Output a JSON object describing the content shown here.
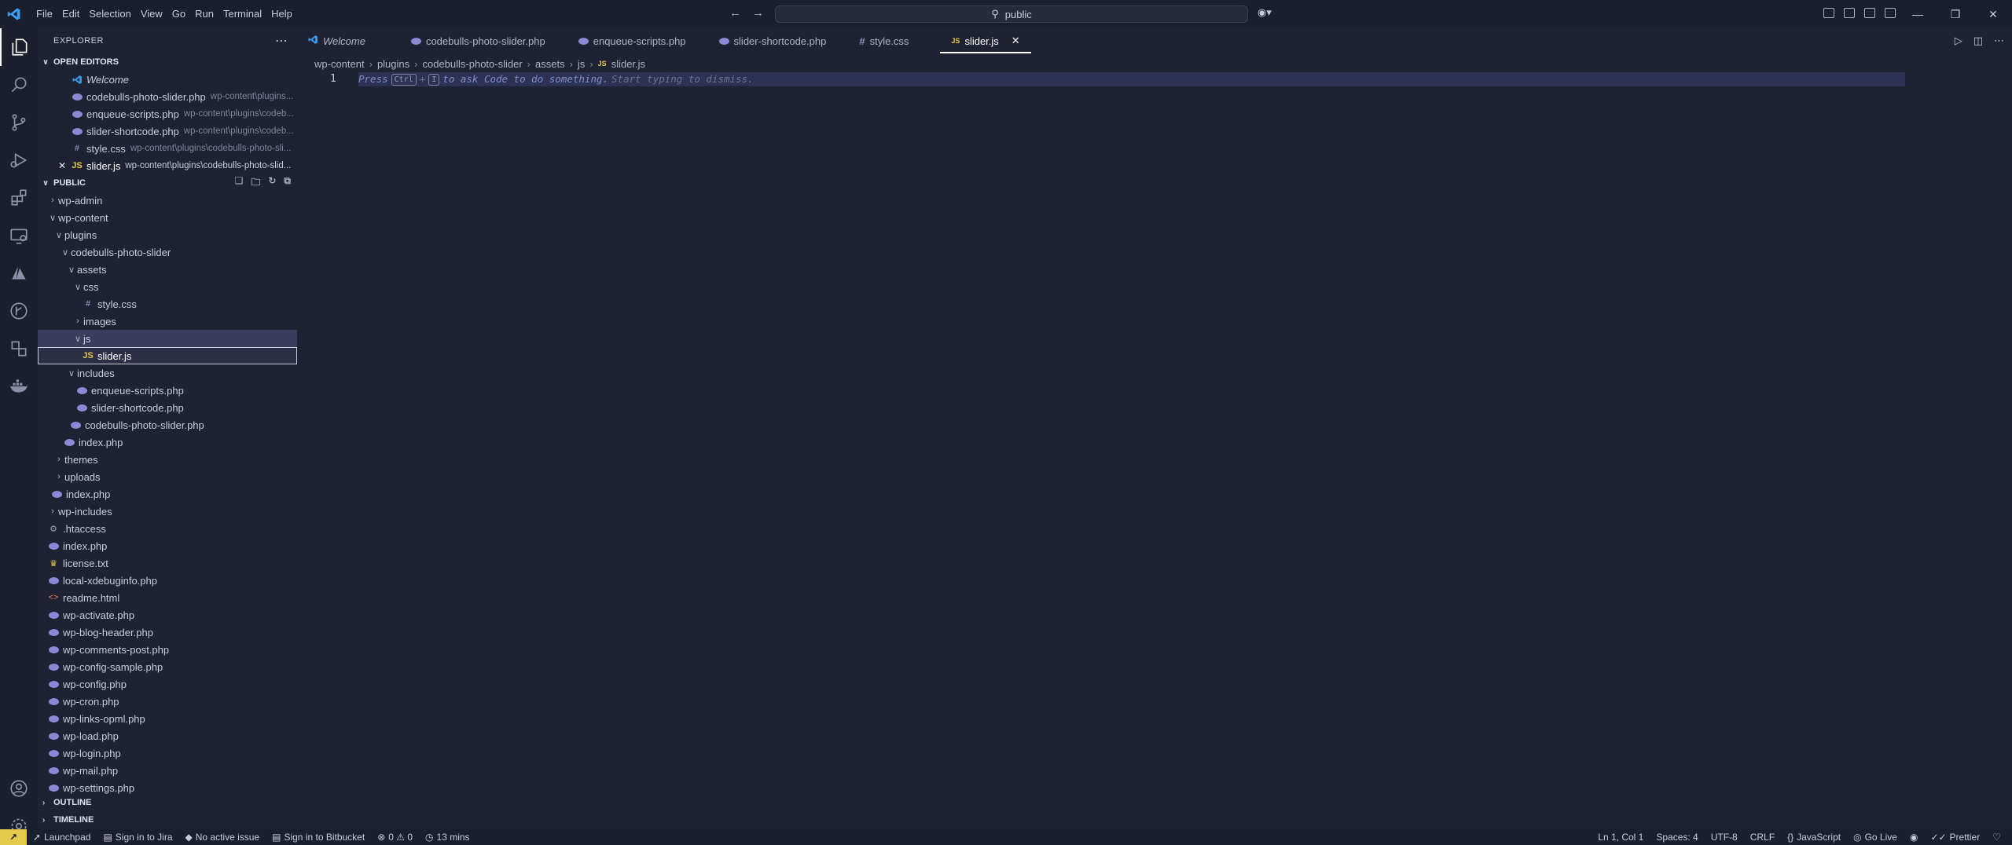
{
  "menu": [
    "File",
    "Edit",
    "Selection",
    "View",
    "Go",
    "Run",
    "Terminal",
    "Help"
  ],
  "command_center": {
    "label": "public"
  },
  "sidebar": {
    "title": "EXPLORER",
    "open_editors": {
      "header": "OPEN EDITORS",
      "items": [
        {
          "name": "Welcome",
          "desc": ""
        },
        {
          "name": "codebulls-photo-slider.php",
          "desc": "wp-content\\plugins..."
        },
        {
          "name": "enqueue-scripts.php",
          "desc": "wp-content\\plugins\\codeb..."
        },
        {
          "name": "slider-shortcode.php",
          "desc": "wp-content\\plugins\\codeb..."
        },
        {
          "name": "style.css",
          "desc": "wp-content\\plugins\\codebulls-photo-sli..."
        },
        {
          "name": "slider.js",
          "desc": "wp-content\\plugins\\codebulls-photo-slid..."
        }
      ]
    },
    "workspace": {
      "header": "PUBLIC",
      "items": [
        "wp-admin",
        "wp-content",
        "plugins",
        "codebulls-photo-slider",
        "assets",
        "css",
        "style.css",
        "images",
        "js",
        "slider.js",
        "includes",
        "enqueue-scripts.php",
        "slider-shortcode.php",
        "codebulls-photo-slider.php",
        "index.php",
        "themes",
        "uploads",
        "index.php",
        "wp-includes",
        ".htaccess",
        "index.php",
        "license.txt",
        "local-xdebuginfo.php",
        "readme.html",
        "wp-activate.php",
        "wp-blog-header.php",
        "wp-comments-post.php",
        "wp-config-sample.php",
        "wp-config.php",
        "wp-cron.php",
        "wp-links-opml.php",
        "wp-load.php",
        "wp-login.php",
        "wp-mail.php",
        "wp-settings.php"
      ]
    },
    "outline": "OUTLINE",
    "timeline": "TIMELINE"
  },
  "tabs": [
    "Welcome",
    "codebulls-photo-slider.php",
    "enqueue-scripts.php",
    "slider-shortcode.php",
    "style.css",
    "slider.js"
  ],
  "breadcrumb": [
    "wp-content",
    "plugins",
    "codebulls-photo-slider",
    "assets",
    "js",
    "slider.js"
  ],
  "editor": {
    "line_number": "1",
    "hint_press": "Press",
    "hint_key1": "Ctrl",
    "hint_plus": "+",
    "hint_key2": "I",
    "hint_text": "to ask Code to do something.",
    "hint_dismiss": "Start typing to dismiss."
  },
  "status": {
    "launchpad": "Launchpad",
    "jira": "Sign in to Jira",
    "issue": "No active issue",
    "bitbucket": "Sign in to Bitbucket",
    "problems": "0 ⚠ 0",
    "time": "13 mins",
    "position": "Ln 1, Col 1",
    "spaces": "Spaces: 4",
    "encoding": "UTF-8",
    "eol": "CRLF",
    "language": "JavaScript",
    "golive": "Go Live",
    "prettier": "Prettier"
  },
  "colors": {
    "background": "#1f2233",
    "titlebar": "#1b1e2d",
    "selection": "#3a3d5c",
    "php_icon": "#8e87d6",
    "js_icon": "#e6c84a"
  }
}
